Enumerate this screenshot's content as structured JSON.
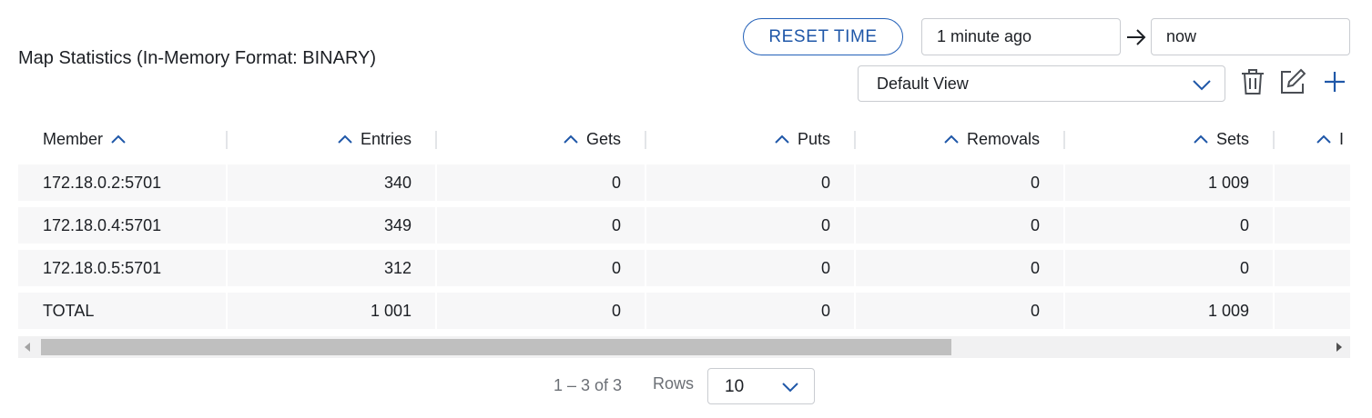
{
  "title": "Map Statistics (In-Memory Format: BINARY)",
  "toolbar": {
    "reset_label": "RESET TIME",
    "time_from": "1 minute ago",
    "time_to": "now",
    "view": "Default View"
  },
  "table": {
    "headers": [
      "Member",
      "Entries",
      "Gets",
      "Puts",
      "Removals",
      "Sets",
      "I"
    ],
    "rows": [
      [
        "172.18.0.2:5701",
        "340",
        "0",
        "0",
        "0",
        "1 009"
      ],
      [
        "172.18.0.4:5701",
        "349",
        "0",
        "0",
        "0",
        "0"
      ],
      [
        "172.18.0.5:5701",
        "312",
        "0",
        "0",
        "0",
        "0"
      ],
      [
        "TOTAL",
        "1 001",
        "0",
        "0",
        "0",
        "1 009"
      ]
    ]
  },
  "pagination": {
    "range": "1 – 3 of 3",
    "rows_label": "Rows",
    "rows_per_page": "10"
  },
  "colors": {
    "accent": "#2360b8",
    "row_bg": "#f7f7f8",
    "border": "#c9ccd1"
  },
  "icons": [
    "arrow-right-icon",
    "chevron-down-icon",
    "trash-icon",
    "edit-icon",
    "plus-icon",
    "sort-asc-icon"
  ]
}
